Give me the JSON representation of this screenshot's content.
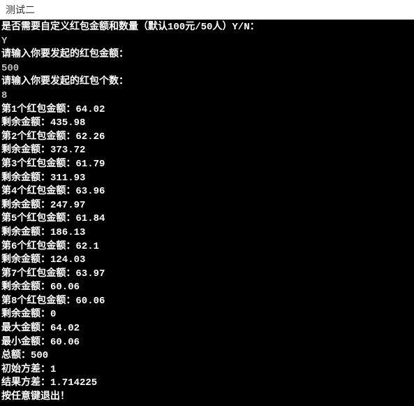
{
  "title": "测试二",
  "lines": [
    {
      "text": "是否需要自定义红包金额和数量（默认100元/50人）Y/N：",
      "input": false
    },
    {
      "text": "Y",
      "input": true
    },
    {
      "text": "请输入你要发起的红包金额：",
      "input": false
    },
    {
      "text": "500",
      "input": true
    },
    {
      "text": "请输入你要发起的红包个数：",
      "input": false
    },
    {
      "text": "8",
      "input": true
    },
    {
      "text": "第1个红包金额：64.02",
      "input": false
    },
    {
      "text": "剩余金额：435.98",
      "input": false
    },
    {
      "text": "第2个红包金额：62.26",
      "input": false
    },
    {
      "text": "剩余金额：373.72",
      "input": false
    },
    {
      "text": "第3个红包金额：61.79",
      "input": false
    },
    {
      "text": "剩余金额：311.93",
      "input": false
    },
    {
      "text": "第4个红包金额：63.96",
      "input": false
    },
    {
      "text": "剩余金额：247.97",
      "input": false
    },
    {
      "text": "第5个红包金额：61.84",
      "input": false
    },
    {
      "text": "剩余金额：186.13",
      "input": false
    },
    {
      "text": "第6个红包金额：62.1",
      "input": false
    },
    {
      "text": "剩余金额：124.03",
      "input": false
    },
    {
      "text": "第7个红包金额：63.97",
      "input": false
    },
    {
      "text": "剩余金额：60.06",
      "input": false
    },
    {
      "text": "第8个红包金额：60.06",
      "input": false
    },
    {
      "text": "剩余金额：0",
      "input": false
    },
    {
      "text": "最大金额：64.02",
      "input": false
    },
    {
      "text": "最小金额：60.06",
      "input": false
    },
    {
      "text": "总额：500",
      "input": false
    },
    {
      "text": "初始方差：1",
      "input": false
    },
    {
      "text": "结果方差：1.714225",
      "input": false
    },
    {
      "text": "按任意键退出！",
      "input": false
    }
  ]
}
